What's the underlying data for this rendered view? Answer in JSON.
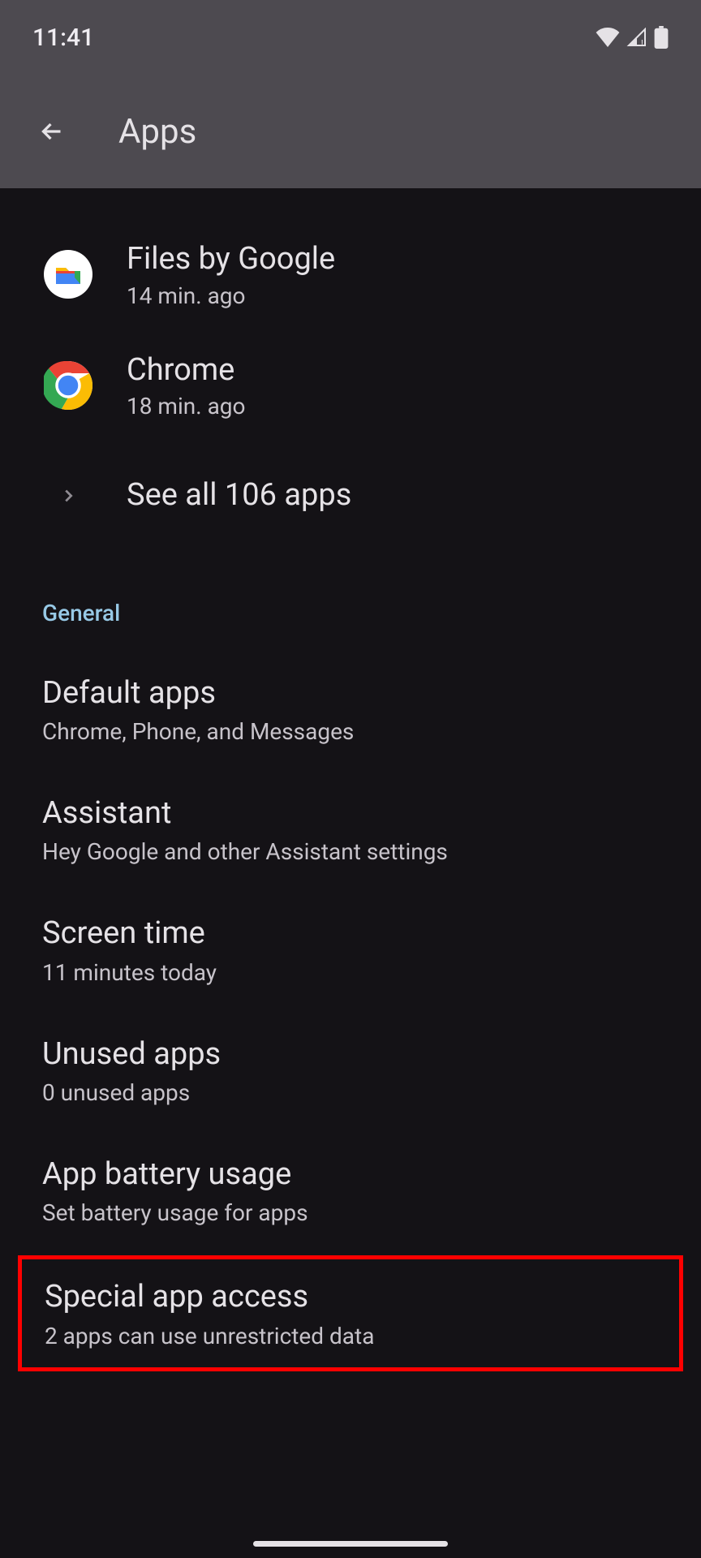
{
  "status": {
    "time": "11:41"
  },
  "header": {
    "title": "Apps"
  },
  "recentApps": [
    {
      "name": "Files by Google",
      "sub": "14 min. ago"
    },
    {
      "name": "Chrome",
      "sub": "18 min. ago"
    }
  ],
  "seeAll": {
    "label": "See all 106 apps"
  },
  "sections": {
    "general": {
      "label": "General",
      "items": [
        {
          "title": "Default apps",
          "sub": "Chrome, Phone, and Messages"
        },
        {
          "title": "Assistant",
          "sub": "Hey Google and other Assistant settings"
        },
        {
          "title": "Screen time",
          "sub": "11 minutes today"
        },
        {
          "title": "Unused apps",
          "sub": "0 unused apps"
        },
        {
          "title": "App battery usage",
          "sub": "Set battery usage for apps"
        },
        {
          "title": "Special app access",
          "sub": "2 apps can use unrestricted data"
        }
      ]
    }
  }
}
